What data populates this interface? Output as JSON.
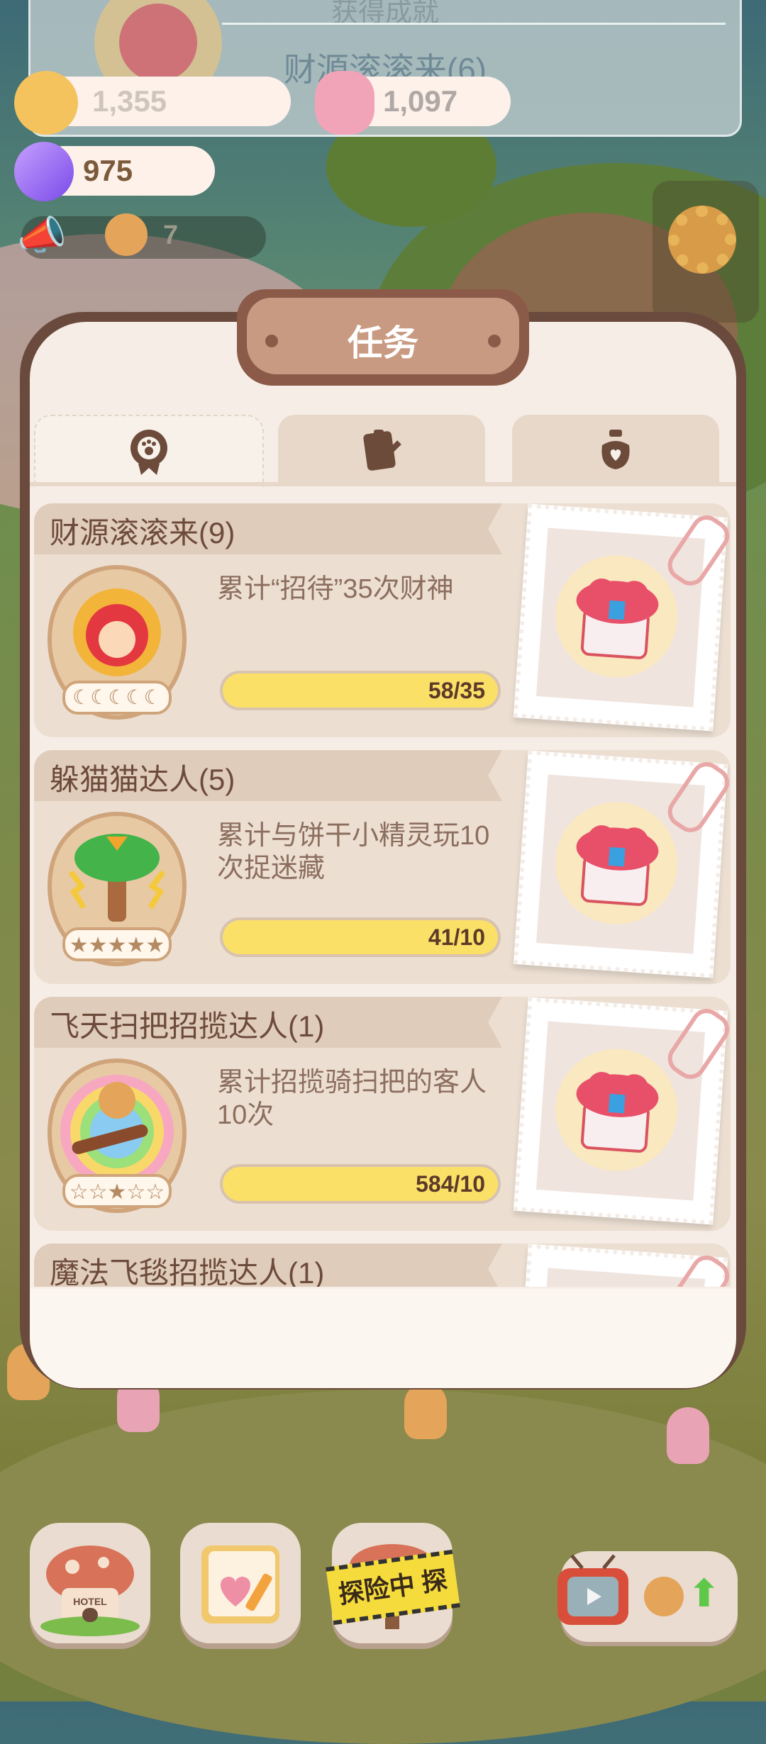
{
  "achievement_banner": {
    "title": "获得成就",
    "subtitle": "财源滚滚来(6)"
  },
  "resources": {
    "cookie_value": "1,355",
    "candy_value": "1,097",
    "gem_value": "975",
    "helpers_count": "7"
  },
  "modal": {
    "title": "任务",
    "tabs": [
      {
        "icon": "paw-medal-icon",
        "active": true
      },
      {
        "icon": "notepad-icon",
        "active": false
      },
      {
        "icon": "pot-heart-icon",
        "active": false
      }
    ],
    "tasks": [
      {
        "title": "财源滚滚来(9)",
        "desc": "累计“招待”35次财神",
        "progress_text": "58/35",
        "fraction": 1.0
      },
      {
        "title": "躲猫猫达人(5)",
        "desc": "累计与饼干小精灵玩10次捉迷藏",
        "progress_text": "41/10",
        "fraction": 1.0
      },
      {
        "title": "飞天扫把招揽达人(1)",
        "desc": "累计招揽骑扫把的客人10次",
        "progress_text": "584/10",
        "fraction": 1.0
      },
      {
        "title": "魔法飞毯招揽达人(1)",
        "desc": "",
        "progress_text": "",
        "fraction": 0
      }
    ]
  },
  "bottom_bar": {
    "hotel_label": "HOTEL",
    "adventure_tag": "探险中 探"
  },
  "colors": {
    "modal_border": "#6a4a3c",
    "progress_fill": "#fbe068",
    "card_bg": "#ecdfd2"
  }
}
